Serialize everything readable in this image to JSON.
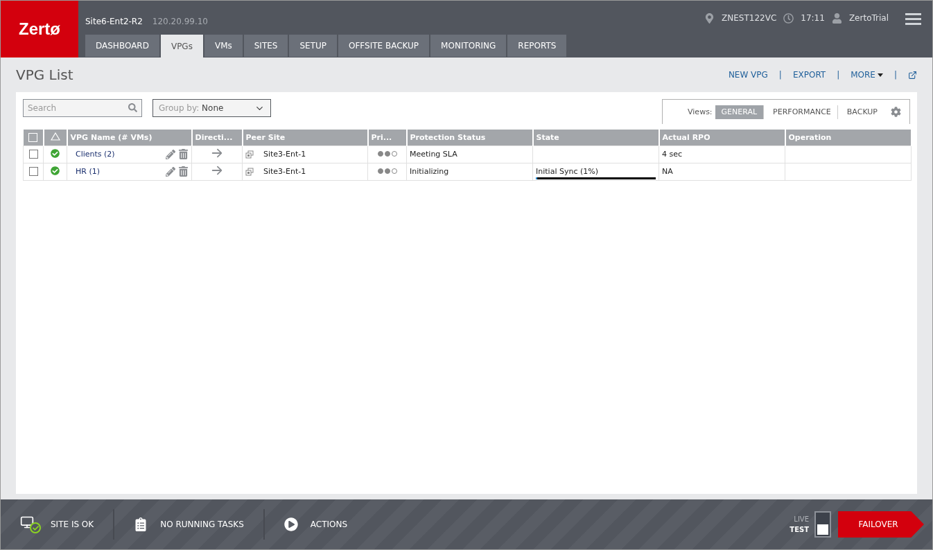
{
  "header": {
    "logo": "Zertø",
    "site_name": "Site6-Ent2-R2",
    "site_ip": "120.20.99.10",
    "location": "ZNEST122VC",
    "time": "17:11",
    "user": "ZertoTrial"
  },
  "tabs": [
    {
      "label": "DASHBOARD",
      "selected": false
    },
    {
      "label": "VPGs",
      "selected": true
    },
    {
      "label": "VMs",
      "selected": false
    },
    {
      "label": "SITES",
      "selected": false
    },
    {
      "label": "SETUP",
      "selected": false
    },
    {
      "label": "OFFSITE BACKUP",
      "selected": false
    },
    {
      "label": "MONITORING",
      "selected": false
    },
    {
      "label": "REPORTS",
      "selected": false
    }
  ],
  "page_title": "VPG List",
  "actions": [
    "NEW VPG",
    "EXPORT",
    "MORE"
  ],
  "action_separators": [
    "|",
    "|",
    "|"
  ],
  "search": {
    "placeholder": "Search"
  },
  "group_by": {
    "label": "Group by:",
    "value": "None"
  },
  "views": {
    "label": "Views:",
    "options": [
      {
        "label": "GENERAL",
        "selected": true
      },
      {
        "label": "PERFORMANCE",
        "selected": false
      },
      {
        "label": "BACKUP",
        "selected": false
      }
    ]
  },
  "table": {
    "select_all": {
      "checked": false
    },
    "columns": [
      "VPG Name (# VMs)",
      "Directi...",
      "Peer Site",
      "Pri...",
      "Protection Status",
      "State",
      "Actual RPO",
      "Operation"
    ],
    "rows": [
      {
        "checked": false,
        "name": "Clients (2)",
        "peer_site": "Site3-Ent-1",
        "stars": 2,
        "protection_status": "Meeting SLA",
        "rpo": "4 sec"
      },
      {
        "checked": false,
        "name": "HR (1)",
        "peer_site": "Site3-Ent-1",
        "stars": 2,
        "protection_status": "Initializing",
        "state": "Initial Sync (1%)",
        "level": 0.01,
        "rpo": "NA"
      }
    ]
  },
  "status_bar": {
    "items": [
      "SITE IS OK",
      "NO RUNNING TASKS",
      "ACTIONS"
    ],
    "mode": [
      {
        "label": "LIVE",
        "selected": false
      },
      {
        "label": "TEST",
        "selected": true
      }
    ],
    "failover": "FAILOVER"
  }
}
